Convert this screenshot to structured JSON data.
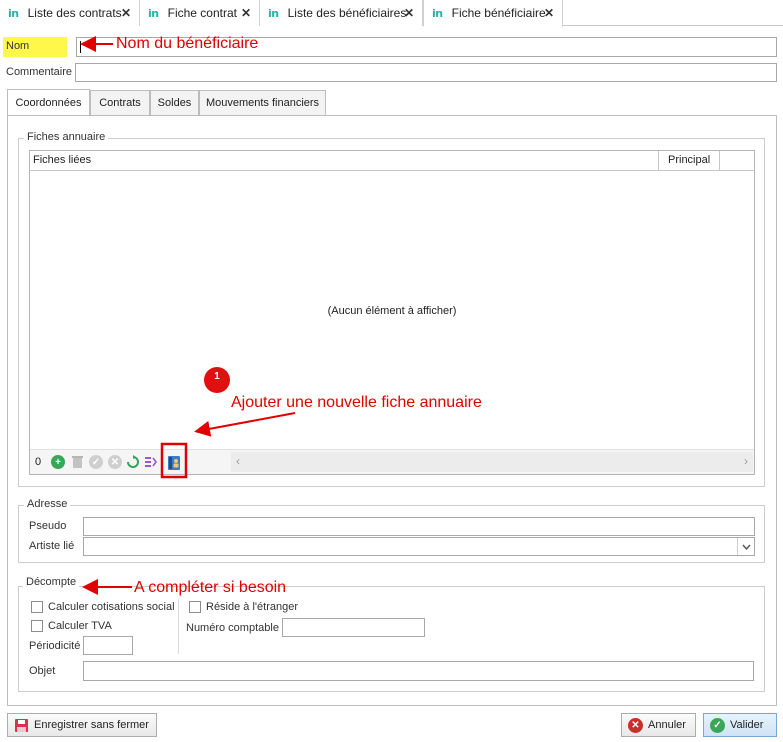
{
  "doc_tabs": [
    {
      "label": "Liste des contrats"
    },
    {
      "label": "Fiche contrat"
    },
    {
      "label": "Liste des bénéficiaires"
    },
    {
      "label": "Fiche bénéficiaire"
    }
  ],
  "tab_logo": "in",
  "close_glyph": "✕",
  "form": {
    "nom_label": "Nom",
    "commentaire_label": "Commentaire",
    "nom_value": "",
    "commentaire_value": ""
  },
  "inner_tabs": [
    "Coordonnées",
    "Contrats",
    "Soldes",
    "Mouvements financiers"
  ],
  "fiches_annuaire": {
    "title": "Fiches annuaire",
    "col_fiches": "Fiches liées",
    "col_principal": "Principal",
    "empty_text": "(Aucun élément à afficher)",
    "count": "0"
  },
  "adresse": {
    "title": "Adresse",
    "pseudo_label": "Pseudo",
    "artiste_label": "Artiste lié"
  },
  "decompte": {
    "title": "Décompte",
    "calc_social": "Calculer cotisations social",
    "calc_tva": "Calculer TVA",
    "reside": "Réside à l'étranger",
    "periodicite": "Périodicité",
    "numero": "Numéro comptable",
    "objet": "Objet"
  },
  "buttons": {
    "save": "Enregistrer sans fermer",
    "cancel": "Annuler",
    "validate": "Valider"
  },
  "annotations": {
    "nom": "Nom du bénéficiaire",
    "ajouter": "Ajouter une nouvelle fiche annuaire",
    "decompte": "A compléter si besoin",
    "badge": "1",
    "color": "#e00000"
  },
  "colors": {
    "highlight": "#fff84a",
    "logo": "#2bb0a4",
    "add_green": "#3aa657",
    "refresh_green": "#2fa65a"
  }
}
